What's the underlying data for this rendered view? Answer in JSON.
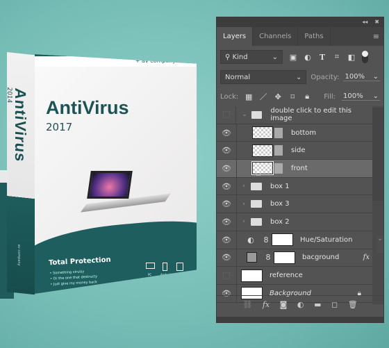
{
  "product": {
    "brand": "+ av company",
    "title": "AntiVirus",
    "year": "2017",
    "side_title": "AntiVirus",
    "side_year": "2014",
    "side_brand": "av company",
    "tagline": "Total Protection",
    "bullets": [
      "• Something viruisy",
      "• Or the one that destructy",
      "• Just give my money back"
    ],
    "devices": [
      "PC",
      "Android",
      "iPad"
    ]
  },
  "panel": {
    "tabs": [
      "Layers",
      "Channels",
      "Paths"
    ],
    "filter_kind": "Kind",
    "blend_mode": "Normal",
    "opacity_label": "Opacity:",
    "opacity": "100%",
    "lock_label": "Lock:",
    "fill_label": "Fill:",
    "fill": "100%",
    "layers": [
      {
        "name": "double click to edit this image",
        "visible": false,
        "type": "group",
        "expanded": true
      },
      {
        "name": "bottom",
        "visible": true,
        "type": "smart-object"
      },
      {
        "name": "side",
        "visible": true,
        "type": "smart-object"
      },
      {
        "name": "front",
        "visible": true,
        "type": "smart-object",
        "selected": true
      },
      {
        "name": "box 1",
        "visible": true,
        "type": "group"
      },
      {
        "name": "box 3",
        "visible": true,
        "type": "group"
      },
      {
        "name": "box 2",
        "visible": true,
        "type": "group"
      },
      {
        "name": "Hue/Saturation",
        "visible": true,
        "type": "adjustment"
      },
      {
        "name": "bacground",
        "visible": true,
        "type": "fill",
        "fx": "fx"
      },
      {
        "name": "reference",
        "visible": false,
        "type": "pixel"
      },
      {
        "name": "Background",
        "visible": true,
        "type": "background",
        "locked": true
      }
    ]
  },
  "colors": {
    "box_teal": "#1e5e5f",
    "panel_bg": "#535353",
    "background": "#7fc4bd"
  }
}
